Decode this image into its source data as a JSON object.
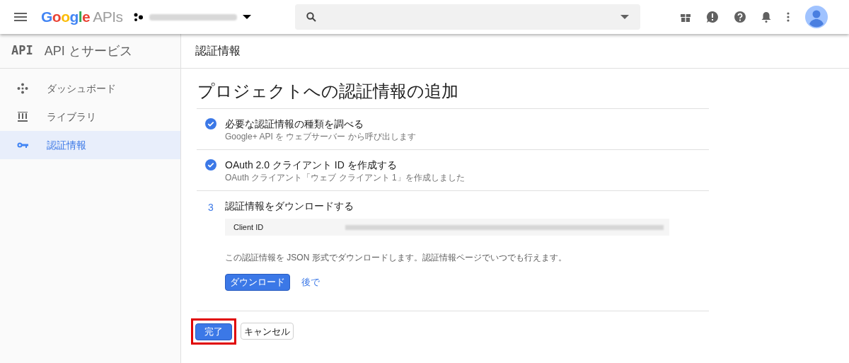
{
  "header": {
    "logo_brand": "Google",
    "logo_product": "APIs"
  },
  "sidebar": {
    "title_icon": "API",
    "title": "API とサービス",
    "items": [
      {
        "label": "ダッシュボード",
        "kind": "dashboard",
        "selected": false
      },
      {
        "label": "ライブラリ",
        "kind": "library",
        "selected": false
      },
      {
        "label": "認証情報",
        "kind": "key",
        "selected": true
      }
    ]
  },
  "page_title": "認証情報",
  "heading": "プロジェクトへの認証情報の追加",
  "steps": [
    {
      "kind": "done",
      "title": "必要な認証情報の種類を調べる",
      "subtitle": "Google+ API を ウェブサーバー から呼び出します"
    },
    {
      "kind": "done",
      "title": "OAuth 2.0 クライアント ID を作成する",
      "subtitle": "OAuth クライアント「ウェブ クライアント 1」を作成しました"
    },
    {
      "kind": "current",
      "number": "3",
      "title": "認証情報をダウンロードする"
    }
  ],
  "download": {
    "field_label": "Client ID",
    "description": "この認証情報を JSON 形式でダウンロードします。認証情報ページでいつでも行えます。",
    "primary_button": "ダウンロード",
    "link": "後で"
  },
  "footer": {
    "done_button": "完了",
    "cancel_button": "キャンセル",
    "done_highlighted": true
  }
}
